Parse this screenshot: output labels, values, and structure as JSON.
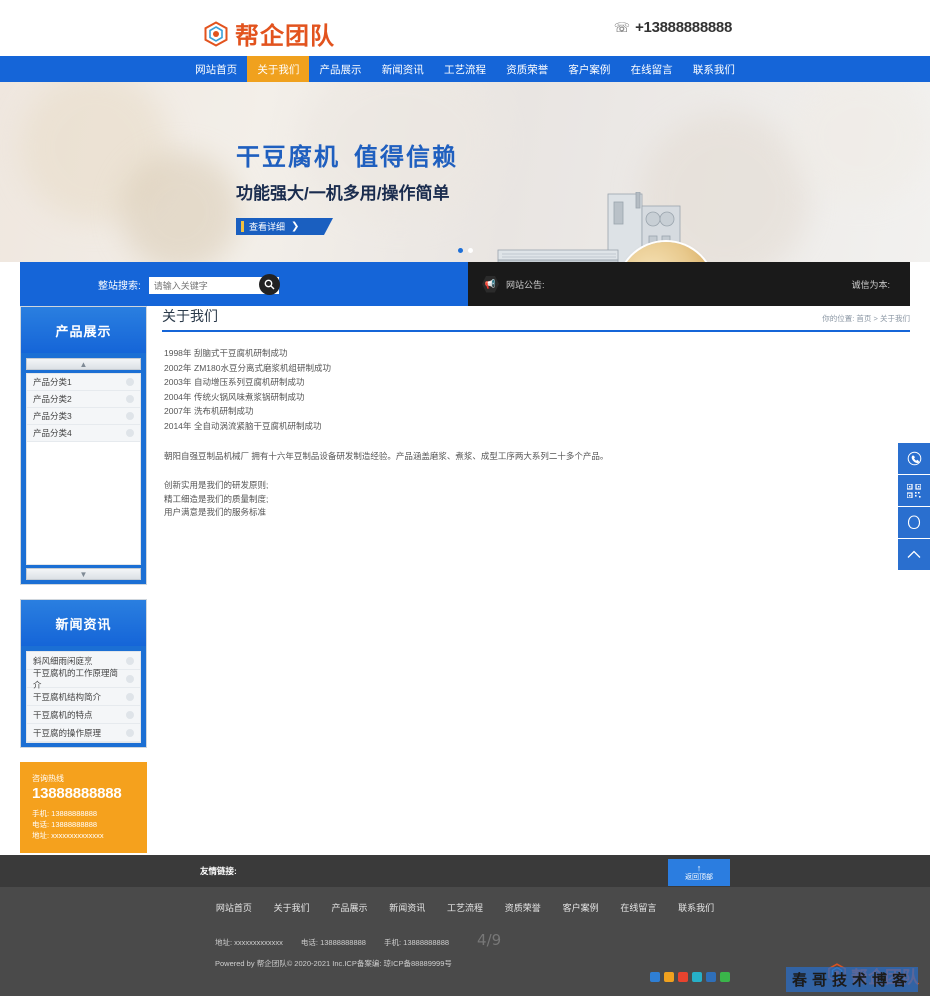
{
  "header": {
    "logo_text": "帮企团队",
    "logo_icon": "hexagon-logo-icon",
    "phone_icon": "telephone-icon",
    "phone": "+13888888888"
  },
  "nav": {
    "items": [
      {
        "label": "网站首页",
        "active": false
      },
      {
        "label": "关于我们",
        "active": true
      },
      {
        "label": "产品展示",
        "active": false
      },
      {
        "label": "新闻资讯",
        "active": false
      },
      {
        "label": "工艺流程",
        "active": false
      },
      {
        "label": "资质荣誉",
        "active": false
      },
      {
        "label": "客户案例",
        "active": false
      },
      {
        "label": "在线留言",
        "active": false
      },
      {
        "label": "联系我们",
        "active": false
      }
    ]
  },
  "banner": {
    "headline_a": "干豆腐机",
    "headline_b": "值得信赖",
    "subhead": "功能强大/一机多用/操作简单",
    "cta": "查看详细",
    "cta_arrow": "❯",
    "dots": 2,
    "active_dot": 1
  },
  "search": {
    "label": "整站搜索:",
    "placeholder": "请输入关键字",
    "value": "",
    "button_icon": "search-icon"
  },
  "notice": {
    "icon": "megaphone-icon",
    "label": "网站公告:",
    "right_text": "诚信为本:"
  },
  "sidebar": {
    "products": {
      "title": "产品展示",
      "scroll_up_icon": "chevron-up-icon",
      "scroll_down_icon": "chevron-down-icon",
      "items": [
        {
          "label": "产品分类1"
        },
        {
          "label": "产品分类2"
        },
        {
          "label": "产品分类3"
        },
        {
          "label": "产品分类4"
        }
      ]
    },
    "news": {
      "title": "新闻资讯",
      "items": [
        {
          "label": "斜风细雨闲庭烹"
        },
        {
          "label": "干豆腐机的工作原理简介"
        },
        {
          "label": "干豆腐机结构简介"
        },
        {
          "label": "干豆腐机的特点"
        },
        {
          "label": "干豆腐的操作原理"
        }
      ]
    },
    "contact": {
      "label": "咨询热线",
      "hotline": "13888888888",
      "mobile": "手机: 13888888888",
      "tel": "电话: 13888888888",
      "address": "地址: xxxxxxxxxxxxxx"
    }
  },
  "content": {
    "title": "关于我们",
    "breadcrumb_prefix": "你的位置:",
    "breadcrumb_home": "首页",
    "breadcrumb_sep": ">",
    "breadcrumb_current": "关于我们",
    "timeline": [
      {
        "year": "1998年",
        "text": "刮脑式干豆腐机研制成功"
      },
      {
        "year": "2002年",
        "text": "ZM180水豆分离式磨浆机组研制成功"
      },
      {
        "year": "2003年",
        "text": "自动增压系列豆腐机研制成功"
      },
      {
        "year": "2004年",
        "text": "传统火锅风味煮浆锅研制成功"
      },
      {
        "year": "2007年",
        "text": "洗布机研制成功"
      },
      {
        "year": "2014年",
        "text": "全自动涡流紧脑干豆腐机研制成功"
      }
    ],
    "paragraph": "朝阳自强豆制品机械厂 拥有十六年豆制品设备研发制造经验。产品涵盖磨浆、煮浆、成型工序两大系列二十多个产品。",
    "principles": [
      "创新实用是我们的研发原则;",
      "精工细造是我们的质量制度;",
      "用户满意是我们的服务标准"
    ]
  },
  "footer": {
    "friend_links_label": "友情链接:",
    "back_to_top": {
      "arrow": "↑",
      "label": "返回顶部"
    },
    "nav": [
      {
        "label": "网站首页"
      },
      {
        "label": "关于我们"
      },
      {
        "label": "产品展示"
      },
      {
        "label": "新闻资讯"
      },
      {
        "label": "工艺流程"
      },
      {
        "label": "资质荣誉"
      },
      {
        "label": "客户案例"
      },
      {
        "label": "在线留言"
      },
      {
        "label": "联系我们"
      }
    ],
    "address": "地址: xxxxxxxxxxxxx",
    "tel": "电话: 13888888888",
    "mobile": "手机: 13888888888",
    "page_indicator": "4/9",
    "copyright": "Powered by 帮企团队© 2020-2021 Inc.ICP备案编: 琼ICP备88889999号",
    "socials": [
      "#2f7fd4",
      "#f0a11e",
      "#e8432e",
      "#27b0c8",
      "#2f6fb8",
      "#3ab54a"
    ]
  },
  "floatbar": {
    "items": [
      {
        "icon": "phone-icon",
        "glyph": "✆"
      },
      {
        "icon": "qrcode-icon",
        "glyph": "▦"
      },
      {
        "icon": "chat-bubble-icon",
        "glyph": "◌"
      },
      {
        "icon": "chevron-up-icon",
        "glyph": "︿"
      }
    ]
  },
  "watermark": {
    "logo_text": "帮企团队",
    "band_text": "春哥技术博客"
  },
  "colors": {
    "primary_blue": "#1565d8",
    "accent_orange": "#f0a11e",
    "logo_orange": "#e2531e",
    "dark_bar": "#1a1a1a",
    "footer_dark": "#4a4a4a"
  }
}
